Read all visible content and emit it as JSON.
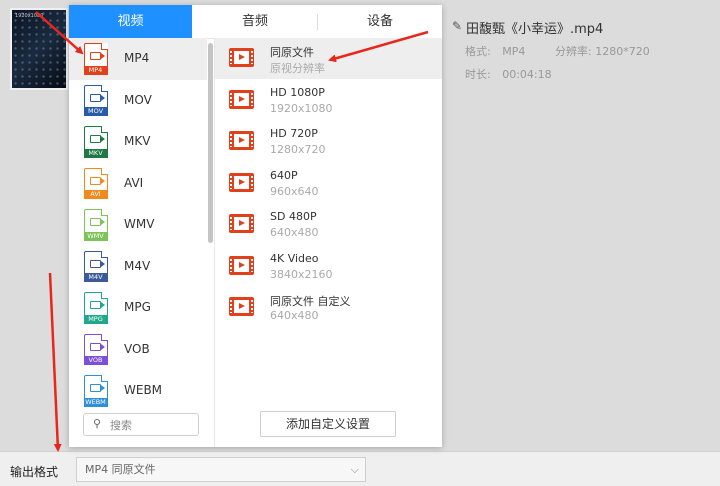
{
  "thumbnail": {
    "label": "1920x1080"
  },
  "file": {
    "title": "田馥甄《小幸运》.mp4",
    "format_label": "格式:",
    "format_value": "MP4",
    "resolution_label": "分辨率:",
    "resolution_value": "1280*720",
    "duration_label": "时长:",
    "duration_value": "00:04:18"
  },
  "tabs": [
    {
      "label": "视频"
    },
    {
      "label": "音频"
    },
    {
      "label": "设备"
    }
  ],
  "formats": [
    {
      "name": "MP4",
      "color": "#E0401A"
    },
    {
      "name": "MOV",
      "color": "#2A5BA8"
    },
    {
      "name": "MKV",
      "color": "#1E7A43"
    },
    {
      "name": "AVI",
      "color": "#F08A1C"
    },
    {
      "name": "WMV",
      "color": "#7CC35A"
    },
    {
      "name": "M4V",
      "color": "#3B5A99"
    },
    {
      "name": "MPG",
      "color": "#1FA88A"
    },
    {
      "name": "VOB",
      "color": "#7B4FD6"
    },
    {
      "name": "WEBM",
      "color": "#2F8FD8"
    }
  ],
  "search": {
    "placeholder": "搜索"
  },
  "resolutions": [
    {
      "name": "同原文件",
      "sub": "原视分辨率"
    },
    {
      "name": "HD 1080P",
      "sub": "1920x1080"
    },
    {
      "name": "HD 720P",
      "sub": "1280x720"
    },
    {
      "name": "640P",
      "sub": "960x640"
    },
    {
      "name": "SD 480P",
      "sub": "640x480"
    },
    {
      "name": "4K Video",
      "sub": "3840x2160"
    },
    {
      "name": "同原文件 自定义",
      "sub": "640x480"
    }
  ],
  "add_custom_button": "添加自定义设置",
  "output": {
    "label": "输出格式",
    "value": "MP4 同原文件"
  },
  "colors": {
    "accent": "#1E90FF",
    "annotation_arrow": "#E8261C"
  }
}
